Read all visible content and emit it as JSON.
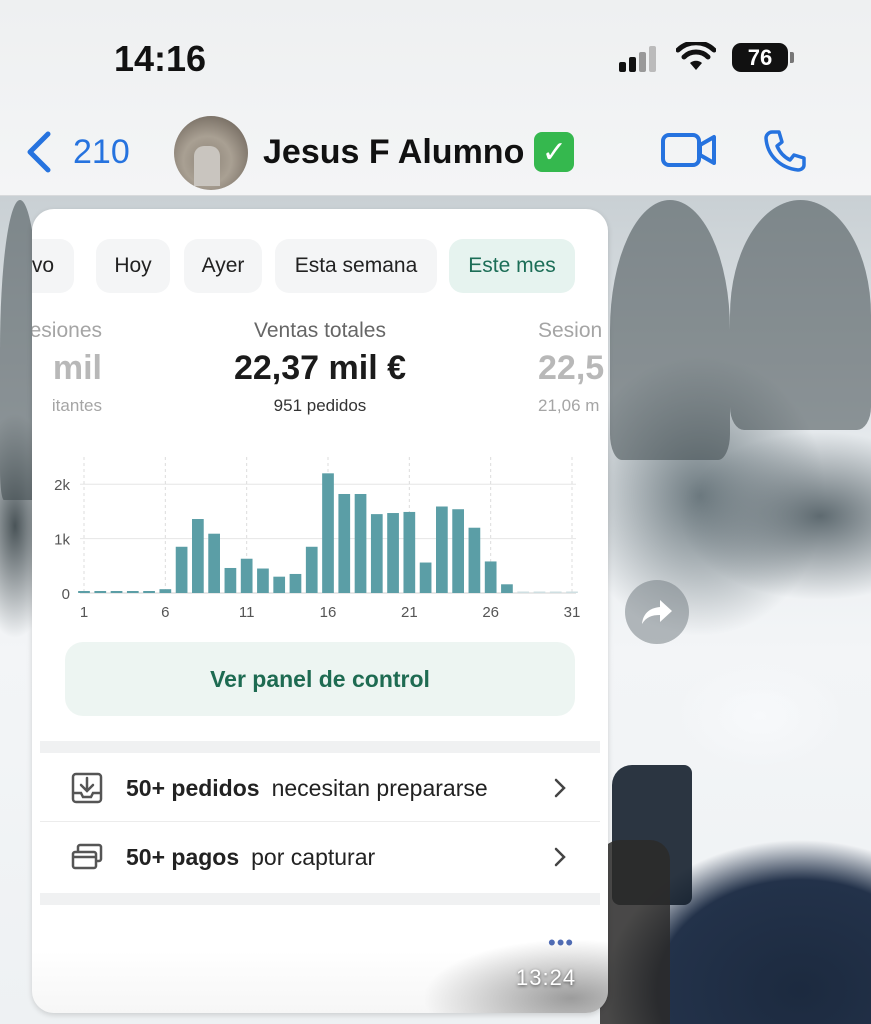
{
  "status_bar": {
    "time": "14:16",
    "battery": "76"
  },
  "header": {
    "back_count": "210",
    "contact_name": "Jesus F Alumno",
    "verified_emoji": "✓"
  },
  "shopify_card": {
    "filters": [
      "vo",
      "Hoy",
      "Ayer",
      "Esta semana",
      "Este mes"
    ],
    "active_filter": "Este mes",
    "metrics": {
      "left": {
        "label": "esiones",
        "value": "mil",
        "sub": "itantes"
      },
      "center": {
        "label": "Ventas totales",
        "value": "22,37 mil €",
        "sub": "951 pedidos"
      },
      "right": {
        "label": "Sesion",
        "value": "22,5",
        "sub": "21,06 m"
      }
    },
    "cta_label": "Ver panel de control",
    "tasks": [
      {
        "bold": "50+ pedidos",
        "text": "necesitan prepararse",
        "icon": "download-box-icon"
      },
      {
        "bold": "50+ pagos",
        "text": "por capturar",
        "icon": "card-payment-icon"
      }
    ]
  },
  "message": {
    "timestamp": "13:24",
    "more": "•••"
  },
  "chart_data": {
    "type": "bar",
    "x": [
      1,
      2,
      3,
      4,
      5,
      6,
      7,
      8,
      9,
      10,
      11,
      12,
      13,
      14,
      15,
      16,
      17,
      18,
      19,
      20,
      21,
      22,
      23,
      24,
      25,
      26,
      27,
      28,
      29,
      30,
      31
    ],
    "values": [
      30,
      30,
      30,
      30,
      30,
      70,
      850,
      1360,
      1090,
      460,
      630,
      450,
      300,
      350,
      850,
      2200,
      1820,
      1820,
      1450,
      1470,
      1490,
      560,
      1590,
      1540,
      1200,
      580,
      160,
      0,
      0,
      0,
      0
    ],
    "xticks": [
      "1",
      "6",
      "11",
      "16",
      "21",
      "26",
      "31"
    ],
    "yticks": [
      "0",
      "1k",
      "2k"
    ],
    "ylim": [
      0,
      2500
    ],
    "grid": true,
    "bar_color": "#5b9ea6"
  }
}
